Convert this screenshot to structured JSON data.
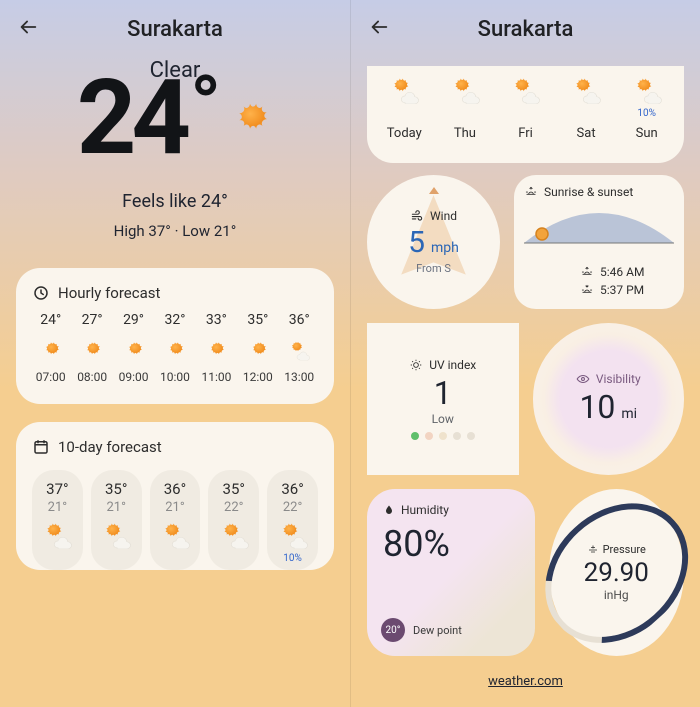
{
  "left": {
    "header": {
      "title": "Surakarta"
    },
    "hero": {
      "condition": "Clear",
      "temp": "24",
      "feels_like": "Feels like 24°",
      "high_low": "High 37° · Low 21°"
    },
    "hourly": {
      "title": "Hourly forecast",
      "items": [
        {
          "temp": "24°",
          "time": "07:00",
          "icon": "sun"
        },
        {
          "temp": "27°",
          "time": "08:00",
          "icon": "sun"
        },
        {
          "temp": "29°",
          "time": "09:00",
          "icon": "sun"
        },
        {
          "temp": "32°",
          "time": "10:00",
          "icon": "sun"
        },
        {
          "temp": "33°",
          "time": "11:00",
          "icon": "sun"
        },
        {
          "temp": "35°",
          "time": "12:00",
          "icon": "sun"
        },
        {
          "temp": "36°",
          "time": "13:00",
          "icon": "sun-cloud"
        }
      ]
    },
    "daily": {
      "title": "10-day forecast",
      "items": [
        {
          "hi": "37°",
          "lo": "21°",
          "icon": "sun-cloud",
          "rain": ""
        },
        {
          "hi": "35°",
          "lo": "21°",
          "icon": "sun-cloud",
          "rain": ""
        },
        {
          "hi": "36°",
          "lo": "21°",
          "icon": "sun-cloud",
          "rain": ""
        },
        {
          "hi": "35°",
          "lo": "22°",
          "icon": "sun-cloud",
          "rain": ""
        },
        {
          "hi": "36°",
          "lo": "22°",
          "icon": "sun-cloud",
          "rain": "10%"
        }
      ]
    }
  },
  "right": {
    "header": {
      "title": "Surakarta"
    },
    "top_days": [
      {
        "label": "Today",
        "icon": "sun-cloud",
        "rain": ""
      },
      {
        "label": "Thu",
        "icon": "sun-cloud",
        "rain": ""
      },
      {
        "label": "Fri",
        "icon": "sun-cloud",
        "rain": ""
      },
      {
        "label": "Sat",
        "icon": "sun-cloud",
        "rain": ""
      },
      {
        "label": "Sun",
        "icon": "sun-cloud",
        "rain": "10%"
      }
    ],
    "wind": {
      "title": "Wind",
      "value": "5",
      "unit": "mph",
      "from": "From S"
    },
    "sun": {
      "title": "Sunrise & sunset",
      "sunrise": "5:46 AM",
      "sunset": "5:37 PM"
    },
    "uv": {
      "title": "UV index",
      "value": "1",
      "label": "Low"
    },
    "visibility": {
      "title": "Visibility",
      "value": "10",
      "unit": "mi"
    },
    "humidity": {
      "title": "Humidity",
      "value": "80%",
      "dew_value": "20°",
      "dew_label": "Dew point"
    },
    "pressure": {
      "title": "Pressure",
      "value": "29.90",
      "unit": "inHg"
    },
    "footer_link": "weather.com"
  }
}
